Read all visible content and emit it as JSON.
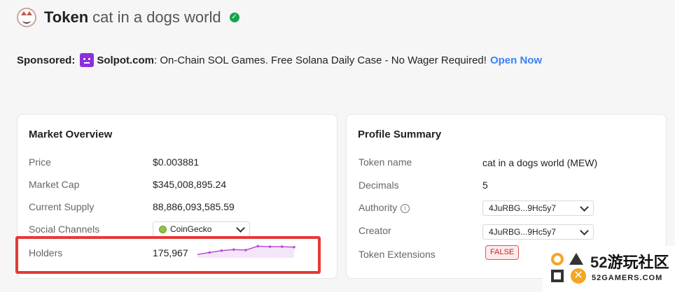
{
  "header": {
    "title_prefix": "Token",
    "title_name": "cat in a dogs world",
    "verified_icon": "check-circle-icon",
    "verified_glyph": "✓"
  },
  "sponsor": {
    "label": "Sponsored:",
    "name": "Solpot.com",
    "text": ": On-Chain SOL Games. Free Solana Daily Case - No Wager Required!",
    "link": "Open Now"
  },
  "market_overview": {
    "title": "Market Overview",
    "price_label": "Price",
    "price_value": "$0.003881",
    "market_cap_label": "Market Cap",
    "market_cap_value": "$345,008,895.24",
    "supply_label": "Current Supply",
    "supply_value": "88,886,093,585.59",
    "social_label": "Social Channels",
    "social_selected": "CoinGecko",
    "holders_label": "Holders",
    "holders_value": "175,967",
    "holders_trend": [
      0.05,
      0.25,
      0.45,
      0.55,
      0.5,
      0.9,
      0.85,
      0.85,
      0.8
    ]
  },
  "profile_summary": {
    "title": "Profile Summary",
    "token_name_label": "Token name",
    "token_name_value": "cat in a dogs world (MEW)",
    "decimals_label": "Decimals",
    "decimals_value": "5",
    "authority_label": "Authority",
    "authority_value": "4JuRBG...9Hc5y7",
    "creator_label": "Creator",
    "creator_value": "4JuRBG...9Hc5y7",
    "extensions_label": "Token Extensions",
    "extensions_value": "FALSE"
  },
  "watermark": {
    "big_num": "52",
    "big_cn": "游玩社区",
    "small": "52GAMERS.COM"
  },
  "colors": {
    "accent_link": "#3b82f6",
    "verified": "#16a34a",
    "highlight": "#e53935",
    "sparkline": "#b84fd6"
  }
}
